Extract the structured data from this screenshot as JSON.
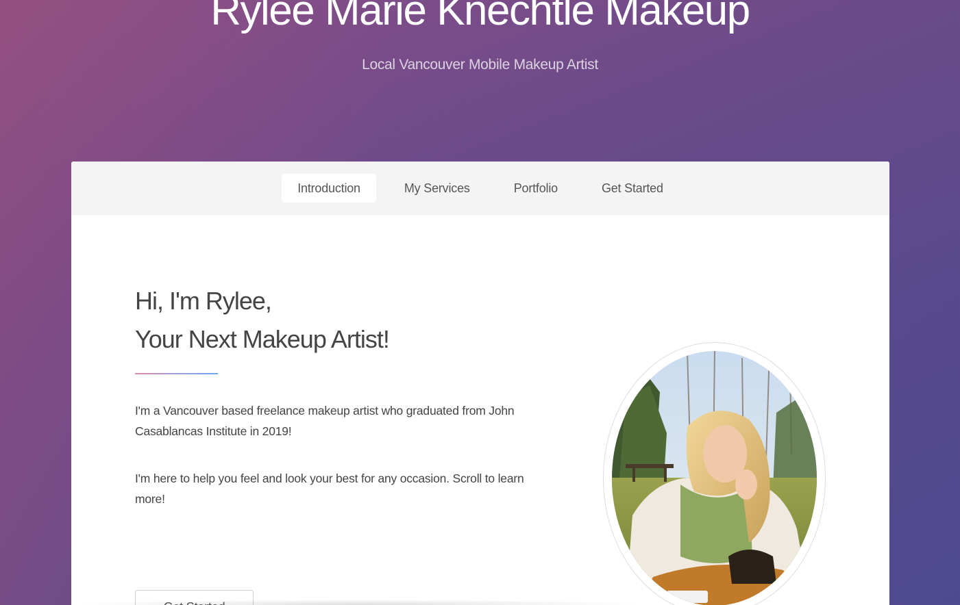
{
  "header": {
    "title": "Rylee Marie Knechtle Makeup",
    "subtitle": "Local Vancouver Mobile Makeup Artist"
  },
  "nav": {
    "items": [
      {
        "label": "Introduction",
        "active": true
      },
      {
        "label": "My Services",
        "active": false
      },
      {
        "label": "Portfolio",
        "active": false
      },
      {
        "label": "Get Started",
        "active": false
      }
    ]
  },
  "intro": {
    "headline_line1": "Hi, I'm Rylee,",
    "headline_line2": "Your Next Makeup Artist!",
    "paragraph1": "I'm a Vancouver based freelance makeup artist who graduated from John Casablancas Institute in 2019!",
    "paragraph2": "I'm here to help you feel and look your best for any occasion. Scroll to learn more!",
    "cta_label": "Get Started"
  },
  "colors": {
    "accent_gradient_start": "#e38ab0",
    "accent_gradient_end": "#6fa8ee",
    "background_purple": "#584a8c"
  }
}
